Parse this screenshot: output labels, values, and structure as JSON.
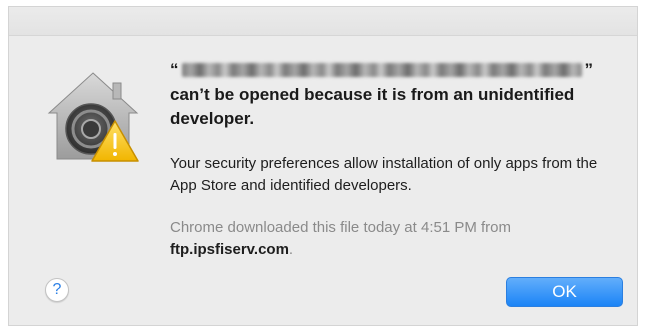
{
  "dialog": {
    "filename_open_quote": "“",
    "filename_close_quote": "”",
    "heading": "can’t be opened because it is from an unidentified developer.",
    "body": "Your security preferences allow installation of only apps from the App Store and identified developers.",
    "source_prefix": "Chrome downloaded this file today at 4:51 PM from",
    "source_host": "ftp.ipsfiserv.com",
    "source_suffix": ".",
    "help_label": "?",
    "ok_label": "OK",
    "icon": "gatekeeper-warning-icon",
    "accent_color": "#1b84f6"
  }
}
